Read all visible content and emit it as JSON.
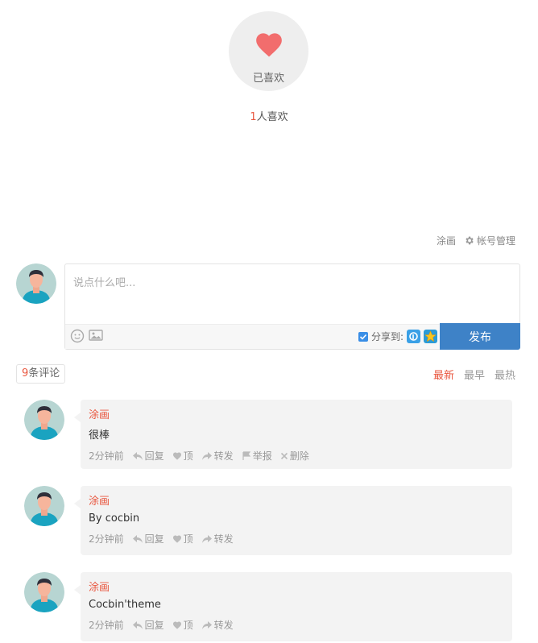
{
  "like": {
    "label": "已喜欢",
    "count": "1",
    "count_suffix": "人喜欢",
    "heart_color": "#f26d6d"
  },
  "account": {
    "username": "涂画",
    "manage_label": "帐号管理"
  },
  "composer": {
    "placeholder": "说点什么吧...",
    "share_label": "分享到:",
    "share_checked": true,
    "publish_label": "发布"
  },
  "comments_header": {
    "count": "9",
    "count_suffix": "条评论",
    "sort_tabs": [
      "最新",
      "最早",
      "最热"
    ],
    "active_tab": "最新"
  },
  "comments": [
    {
      "author": "涂画",
      "text": "很棒",
      "time": "2分钟前",
      "reply": "回复",
      "like": "顶",
      "forward": "转发",
      "report": "举报",
      "delete": "删除"
    },
    {
      "author": "涂画",
      "text": "By cocbin",
      "time": "2分钟前",
      "reply": "回复",
      "like": "顶",
      "forward": "转发"
    },
    {
      "author": "涂画",
      "text": "Cocbin'theme",
      "time": "2分钟前",
      "reply": "回复",
      "like": "顶",
      "forward": "转发"
    }
  ],
  "colors": {
    "accent": "#e9573f",
    "publish_button": "#3e82c7",
    "bubble_bg": "#f3f3f3"
  }
}
